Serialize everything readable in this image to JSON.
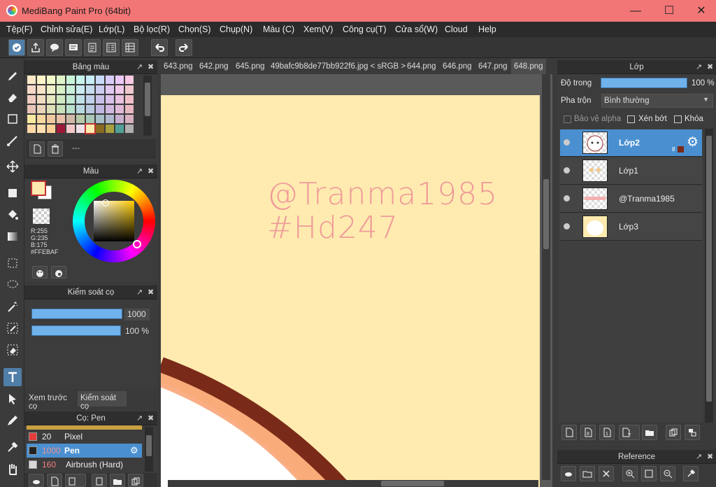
{
  "window": {
    "title": "MediBang Paint Pro (64bit)"
  },
  "menu": [
    "Tệp(F)",
    "Chỉnh sửa(E)",
    "Lớp(L)",
    "Bộ lọc(R)",
    "Chọn(S)",
    "Chụp(N)",
    "Màu (C)",
    "Xem(V)",
    "Công cụ(T)",
    "Cửa sổ(W)",
    "Cloud",
    "Help"
  ],
  "palette": {
    "title": "Bảng màu",
    "brush_name_placeholder": "---"
  },
  "color": {
    "title": "Màu",
    "r": "R:255",
    "g": "G:235",
    "b": "B:175",
    "hex": "#FFEBAF",
    "foreground": "#FFEBAF"
  },
  "brush_control": {
    "title": "Kiểm soát cọ",
    "size": "1000",
    "opacity": "100 %"
  },
  "brush_tabs": [
    "Xem trước cọ",
    "Kiểm soát cọ"
  ],
  "brush_list": {
    "title": "Cọ: Pen",
    "items": [
      {
        "size": "20",
        "name": "Pixel",
        "color": "#e43b3b"
      },
      {
        "size": "1000",
        "name": "Pen",
        "color": "#222222"
      },
      {
        "size": "160",
        "name": "Airbrush (Hard)",
        "color": "#d8d8d8"
      }
    ]
  },
  "canvas_tabs": [
    "643.png",
    "642.png",
    "645.png",
    "49bafc9b8de77bb922f6.jpg < sRGB >",
    "644.png",
    "646.png",
    "647.png",
    "648.png"
  ],
  "canvas": {
    "watermark_line1": "@Tranma1985",
    "watermark_line2": "#Hd247",
    "bg_color": "#FFEBAF"
  },
  "layers": {
    "title": "Lớp",
    "opacity_label": "Độ trong",
    "opacity_value": "100 %",
    "blend_label": "Pha trộn",
    "blend_value": "Bình thường",
    "protect_alpha": "Bảo vệ alpha",
    "clipping": "Xén bớt",
    "lock": "Khóa",
    "items": [
      {
        "name": "Lớp2",
        "selected": true,
        "badge": "8"
      },
      {
        "name": "Lớp1",
        "selected": false
      },
      {
        "name": "@Tranma1985",
        "selected": false
      },
      {
        "name": "Lớp3",
        "selected": false
      }
    ]
  },
  "reference": {
    "title": "Reference"
  }
}
